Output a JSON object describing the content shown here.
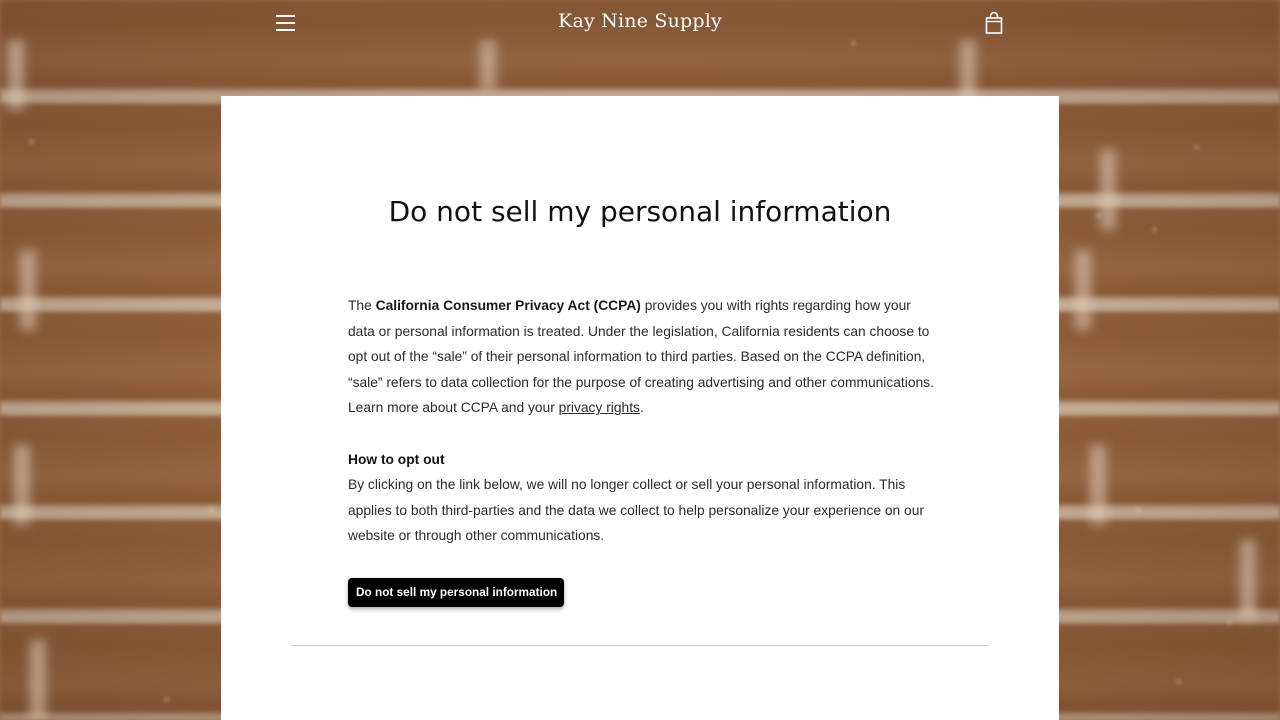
{
  "header": {
    "store_name": "Kay Nine Supply",
    "menu_icon": "hamburger-menu-icon",
    "cart_icon": "shopping-bag-icon",
    "icon_color": "#ffffff"
  },
  "page": {
    "title": "Do not sell my personal information",
    "intro": {
      "prefix": "The ",
      "act_name": "California Consumer Privacy Act (CCPA)",
      "body": " provides you with rights regarding how your data or personal information is treated. Under the legislation, California residents can choose to opt out of the “sale” of their personal information to third parties. Based on the CCPA definition, “sale” refers to data collection for the purpose of creating advertising and other communications. Learn more about CCPA and your ",
      "link_text": "privacy rights",
      "suffix": "."
    },
    "opt_out": {
      "heading": "How to opt out",
      "body": "By clicking on the link below, we will no longer collect or sell your personal information. This applies to both third-parties and the data we collect to help personalize your experience on our website or through other communications."
    },
    "button_label": "Do not sell my personal information"
  },
  "colors": {
    "card_background": "#ffffff",
    "button_background": "#000000",
    "button_text": "#ffffff",
    "body_text": "#2b2b2b"
  }
}
